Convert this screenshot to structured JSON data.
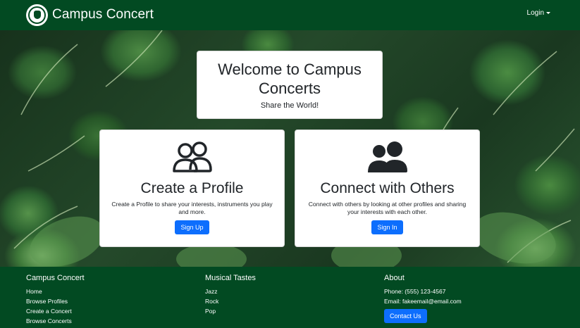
{
  "navbar": {
    "brand": "Campus Concert",
    "login_label": "Login"
  },
  "welcome": {
    "title": "Welcome to Campus Concerts",
    "subtitle": "Share the World!"
  },
  "features": [
    {
      "title": "Create a Profile",
      "description": "Create a Profile to share your interests, instruments you play and more.",
      "button": "Sign Up",
      "icon": "users-outline-icon"
    },
    {
      "title": "Connect with Others",
      "description": "Connect with others by looking at other profiles and sharing your interests with each other.",
      "button": "Sign In",
      "icon": "users-solid-icon"
    }
  ],
  "footer": {
    "col1": {
      "heading": "Campus Concert",
      "links": [
        "Home",
        "Browse Profiles",
        "Create a Concert",
        "Browse Concerts"
      ]
    },
    "col2": {
      "heading": "Musical Tastes",
      "links": [
        "Jazz",
        "Rock",
        "Pop"
      ]
    },
    "col3": {
      "heading": "About",
      "phone": "Phone: (555) 123-4567",
      "email": "Email: fakeemail@email.com",
      "button": "Contact Us"
    }
  },
  "colors": {
    "brand_green": "#024a22",
    "primary_button": "#0d6efd"
  }
}
